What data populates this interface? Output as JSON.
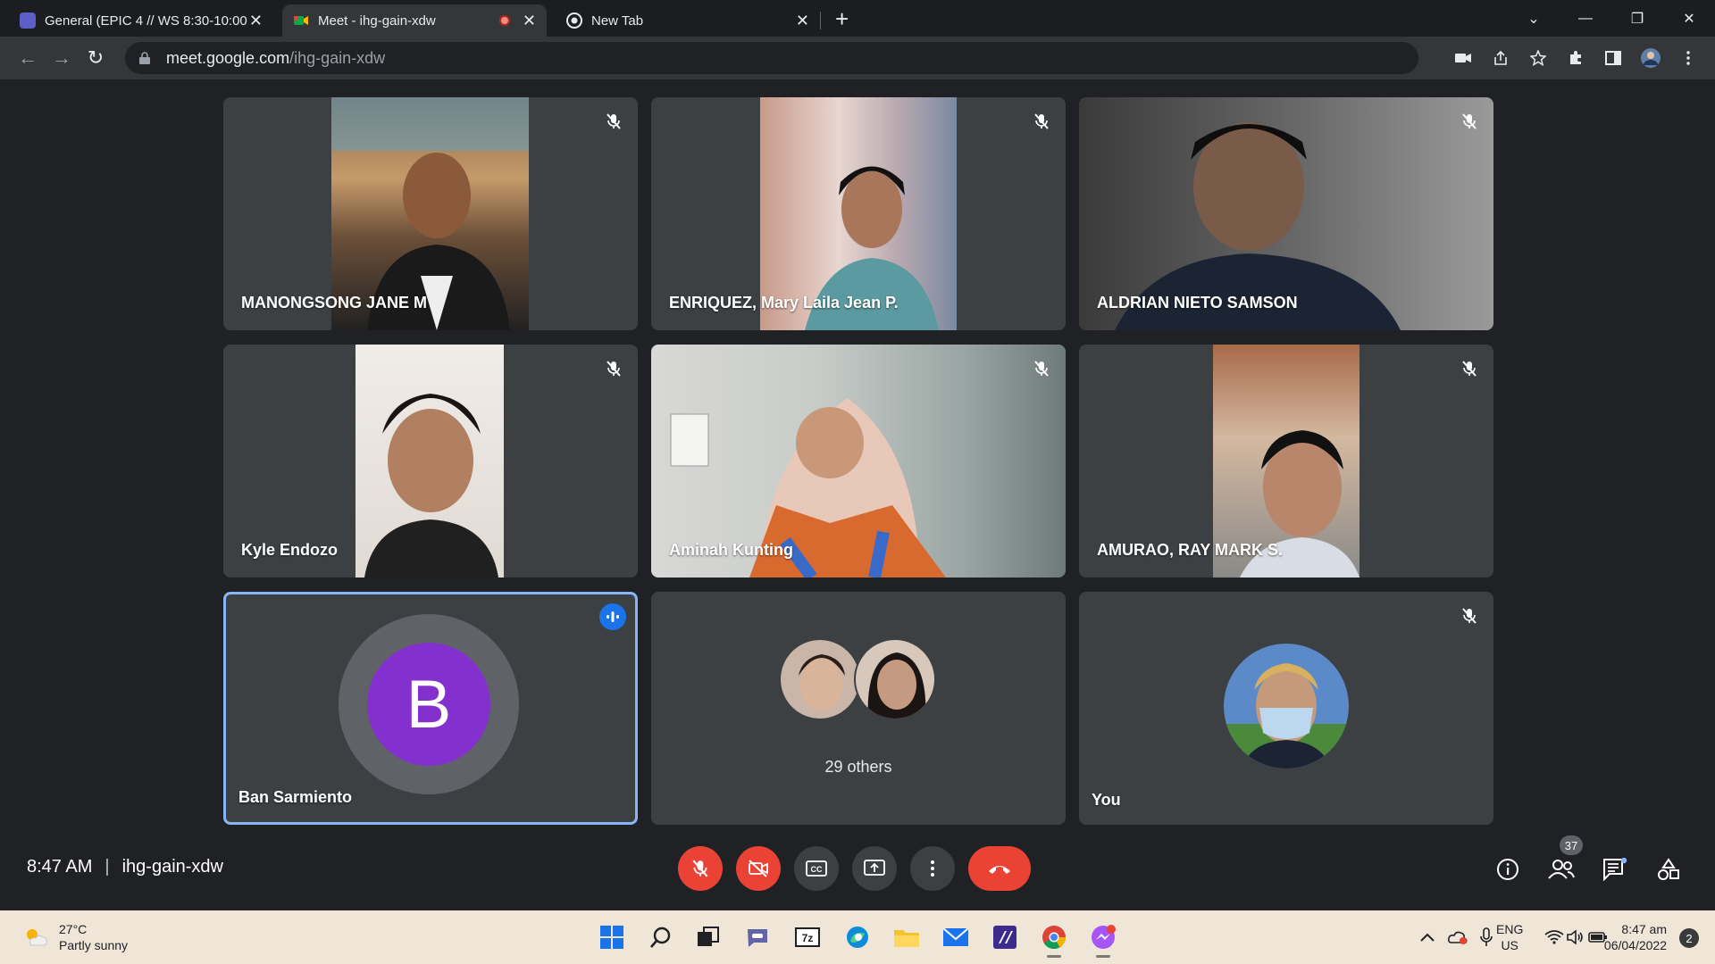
{
  "browser": {
    "tabs": [
      {
        "label": "General (EPIC 4 // WS 8:30-10:00",
        "active": false
      },
      {
        "label": "Meet - ihg-gain-xdw",
        "active": true
      },
      {
        "label": "New Tab",
        "active": false
      }
    ],
    "close_glyph": "✕",
    "new_tab_glyph": "+",
    "url_host": "meet.google.com",
    "url_path": "/ihg-gain-xdw"
  },
  "meet": {
    "participants": [
      {
        "name": "MANONGSONG JANE M",
        "muted": true
      },
      {
        "name": "ENRIQUEZ, Mary Laila Jean P.",
        "muted": true
      },
      {
        "name": "ALDRIAN NIETO SAMSON",
        "muted": true
      },
      {
        "name": "Kyle Endozo",
        "muted": true
      },
      {
        "name": "Aminah Kunting",
        "muted": true
      },
      {
        "name": "AMURAO, RAY MARK S.",
        "muted": true
      },
      {
        "name": "Ban Sarmiento",
        "muted": false,
        "speaking": true,
        "avatar_letter": "B"
      },
      {
        "name": "",
        "others_label": "29 others"
      },
      {
        "name": "You",
        "muted": true
      }
    ],
    "bottom_bar": {
      "time": "8:47 AM",
      "meeting_code": "ihg-gain-xdw",
      "people_count": "37"
    },
    "colors": {
      "end_call": "#ea4335",
      "speaking_border": "#8ab4f8",
      "avatar": "#8430ce"
    }
  },
  "taskbar": {
    "weather_temp": "27°C",
    "weather_desc": "Partly sunny",
    "lang_line1": "ENG",
    "lang_line2": "US",
    "clock_time": "8:47 am",
    "clock_date": "06/04/2022",
    "notification_count": "2"
  }
}
